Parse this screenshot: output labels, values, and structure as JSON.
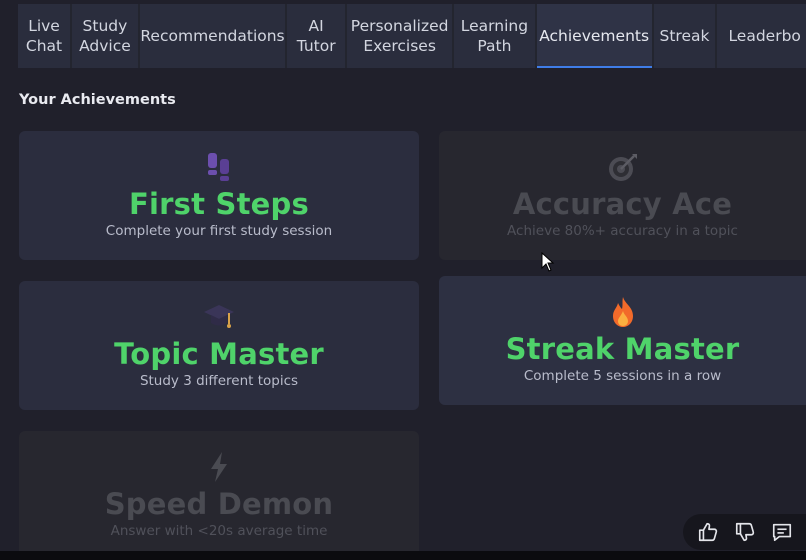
{
  "tabs": [
    {
      "label": "Live\nChat",
      "active": false
    },
    {
      "label": "Study\nAdvice",
      "active": false
    },
    {
      "label": "Recommendations",
      "active": false
    },
    {
      "label": "AI\nTutor",
      "active": false
    },
    {
      "label": "Personalized\nExercises",
      "active": false
    },
    {
      "label": "Learning\nPath",
      "active": false
    },
    {
      "label": "Achievements",
      "active": true
    },
    {
      "label": "Streak",
      "active": false
    },
    {
      "label": "Leaderbo",
      "active": false
    }
  ],
  "section_title": "Your Achievements",
  "achievements": [
    {
      "title": "First Steps",
      "description": "Complete your first study session",
      "icon": "footprints-icon",
      "unlocked": true
    },
    {
      "title": "Accuracy Ace",
      "description": "Achieve 80%+ accuracy in a topic",
      "icon": "target-icon",
      "unlocked": false
    },
    {
      "title": "Topic Master",
      "description": "Study 3 different topics",
      "icon": "graduation-cap-icon",
      "unlocked": true
    },
    {
      "title": "Streak Master",
      "description": "Complete 5 sessions in a row",
      "icon": "fire-icon",
      "unlocked": true
    },
    {
      "title": "Speed Demon",
      "description": "Answer with <20s average time",
      "icon": "lightning-icon",
      "unlocked": false
    }
  ],
  "feedback": {
    "icons": [
      "thumbs-up-icon",
      "thumbs-down-icon",
      "comment-icon"
    ]
  },
  "colors": {
    "accent": "#4fd36a",
    "active_tab_underline": "#3f7de8",
    "background": "#20202b"
  }
}
